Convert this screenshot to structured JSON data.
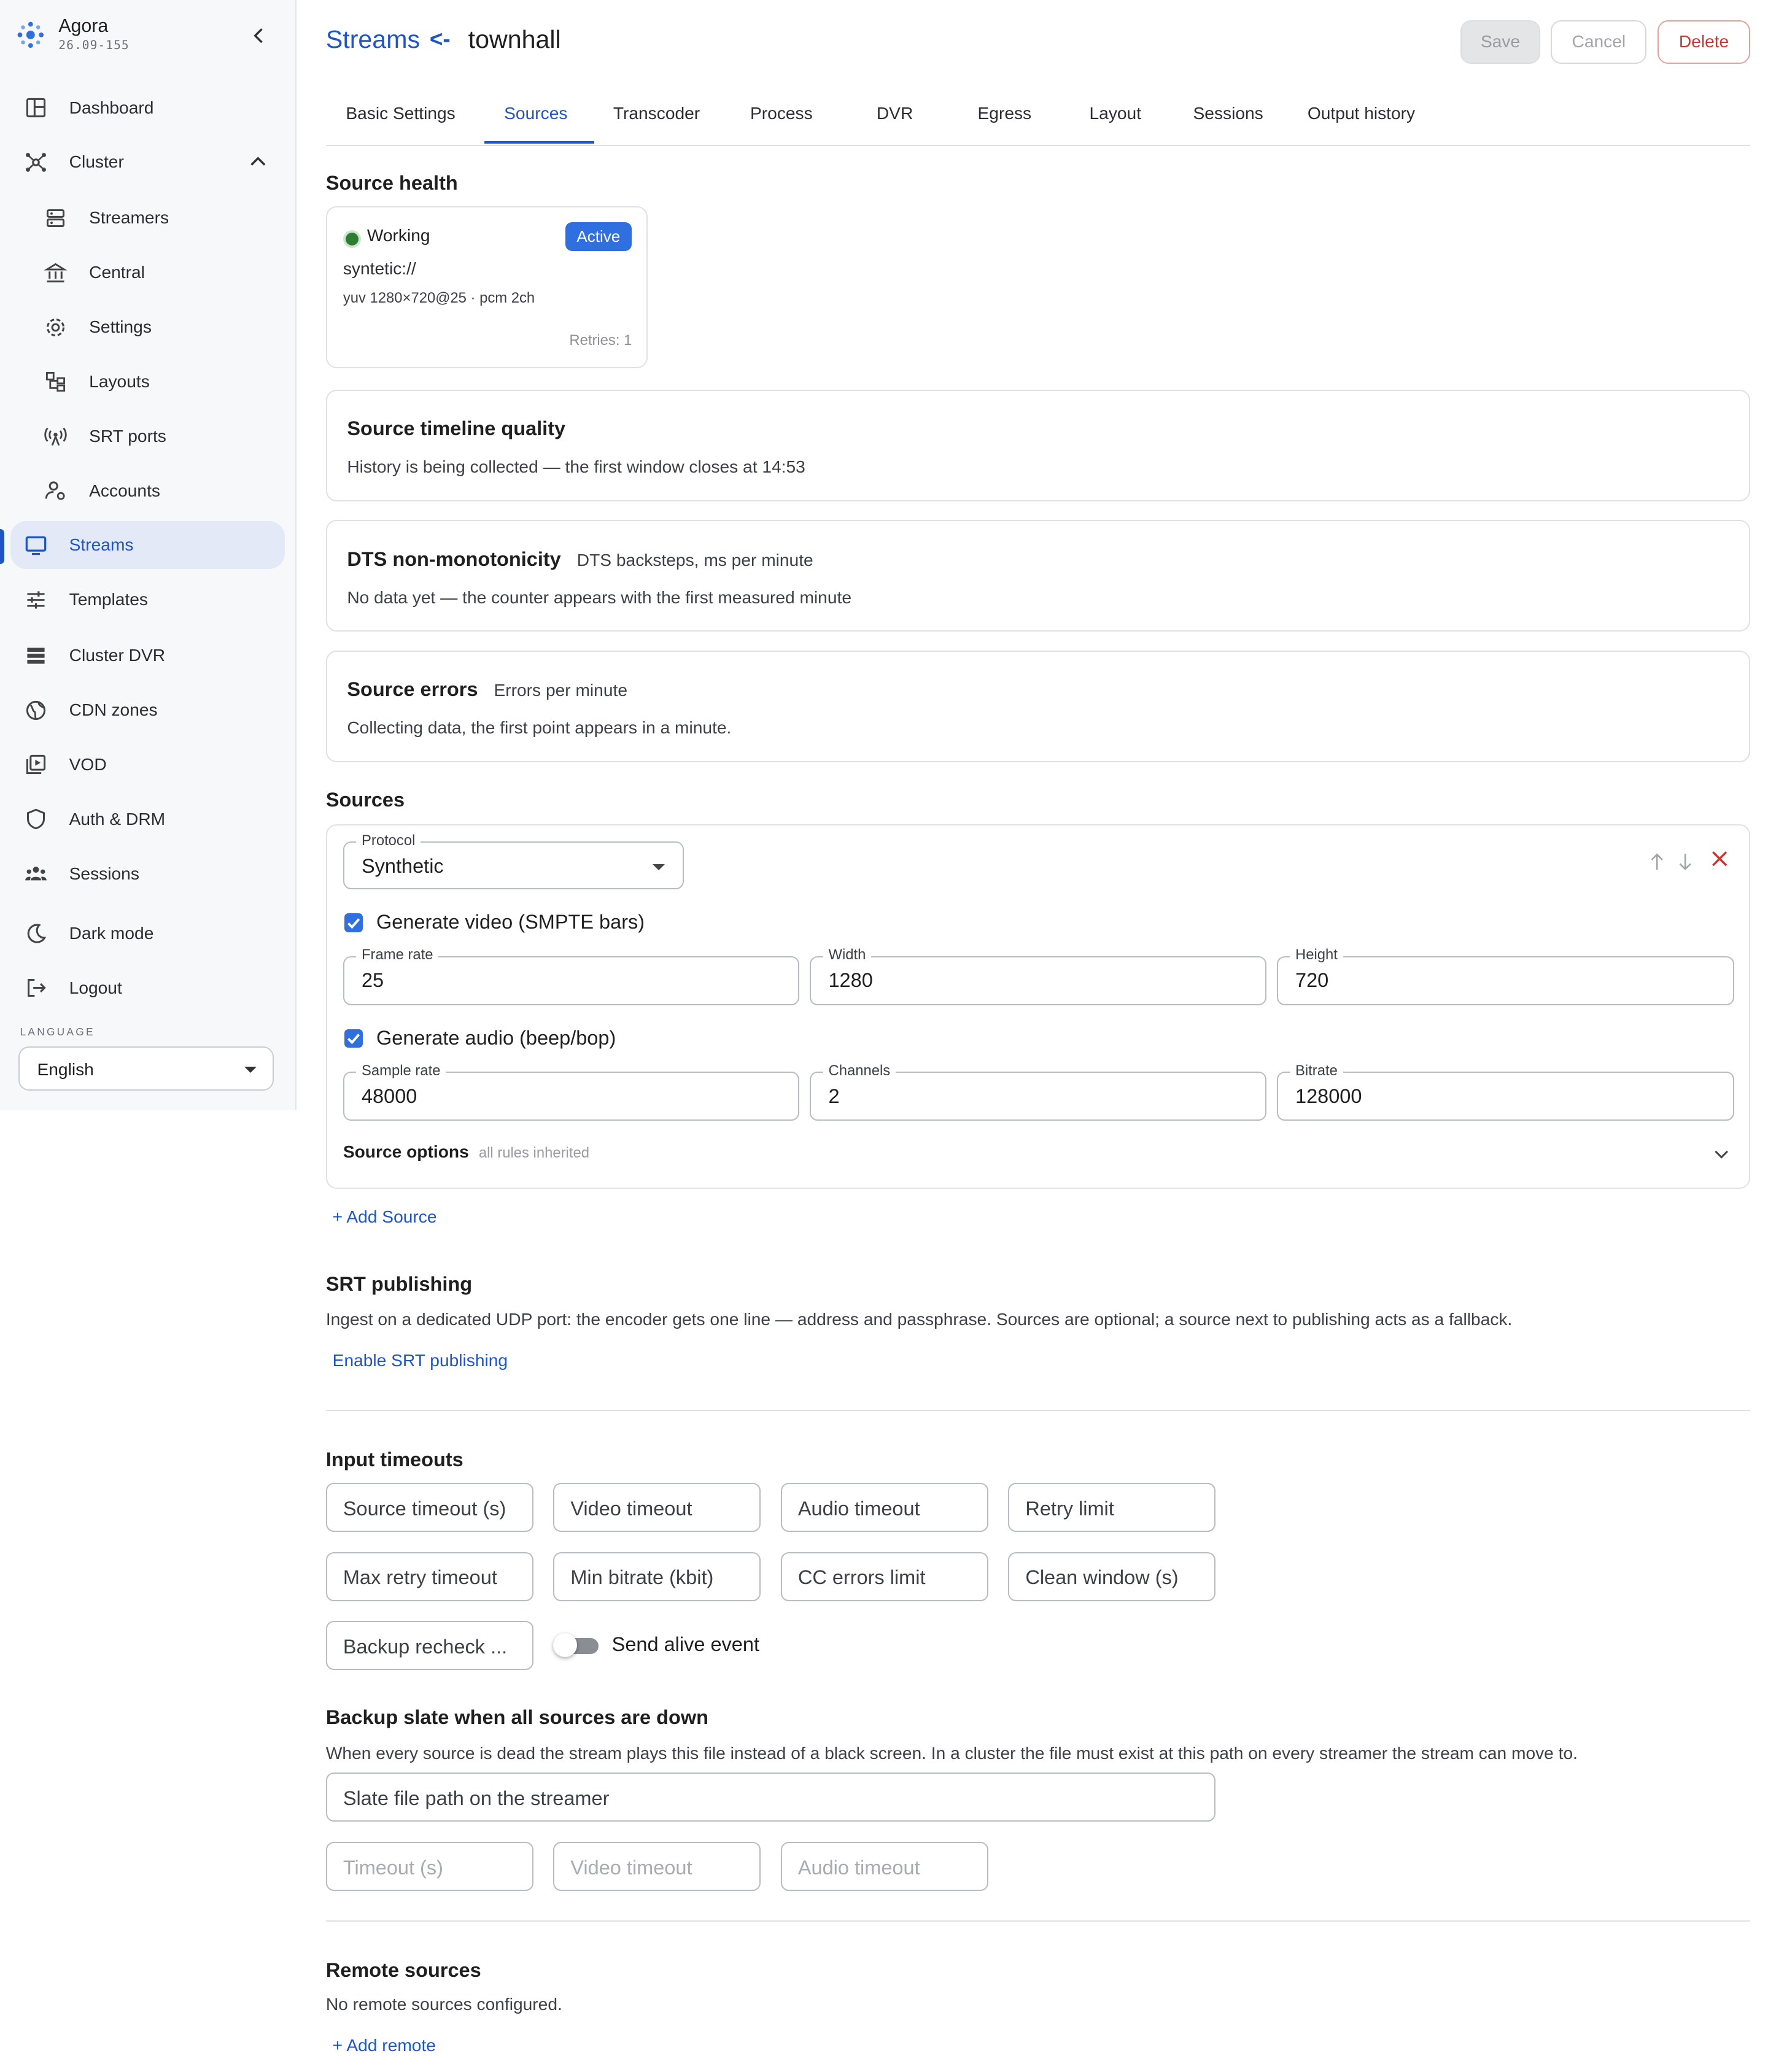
{
  "app": {
    "name": "Agora",
    "version": "26.09-155"
  },
  "sidebar": {
    "items": [
      {
        "label": "Dashboard"
      },
      {
        "label": "Cluster"
      },
      {
        "label": "Streamers"
      },
      {
        "label": "Central"
      },
      {
        "label": "Settings"
      },
      {
        "label": "Layouts"
      },
      {
        "label": "SRT ports"
      },
      {
        "label": "Accounts"
      },
      {
        "label": "Streams"
      },
      {
        "label": "Templates"
      },
      {
        "label": "Cluster DVR"
      },
      {
        "label": "CDN zones"
      },
      {
        "label": "VOD"
      },
      {
        "label": "Auth & DRM"
      },
      {
        "label": "Sessions"
      },
      {
        "label": "Dark mode"
      },
      {
        "label": "Logout"
      }
    ],
    "language_label": "LANGUAGE",
    "language_value": "English"
  },
  "header": {
    "breadcrumb": "Streams",
    "breadcrumb_arrow": "<-",
    "stream_name": "townhall",
    "save": "Save",
    "cancel": "Cancel",
    "delete": "Delete"
  },
  "tabs": [
    {
      "label": "Basic Settings"
    },
    {
      "label": "Sources"
    },
    {
      "label": "Transcoder"
    },
    {
      "label": "Process"
    },
    {
      "label": "DVR"
    },
    {
      "label": "Egress"
    },
    {
      "label": "Layout"
    },
    {
      "label": "Sessions"
    },
    {
      "label": "Output history"
    }
  ],
  "source_health": {
    "title": "Source health",
    "status": "Working",
    "status_color": "#2e7d32",
    "badge": "Active",
    "uri": "syntetic://",
    "format": "yuv 1280×720@25 · pcm 2ch",
    "retries": "Retries: 1"
  },
  "timeline": {
    "title": "Source timeline quality",
    "message": "History is being collected — the first window closes at 14:53"
  },
  "dts": {
    "title": "DTS non-monotonicity",
    "subtitle": "DTS backsteps, ms per minute",
    "message": "No data yet — the counter appears with the first measured minute"
  },
  "errors": {
    "title": "Source errors",
    "subtitle": "Errors per minute",
    "message": "Collecting data, the first point appears in a minute."
  },
  "sources": {
    "title": "Sources",
    "protocol_label": "Protocol",
    "protocol_value": "Synthetic",
    "video_checkbox": "Generate video (SMPTE bars)",
    "video_checked": true,
    "frame_rate_label": "Frame rate",
    "frame_rate": "25",
    "width_label": "Width",
    "width": "1280",
    "height_label": "Height",
    "height": "720",
    "audio_checkbox": "Generate audio (beep/bop)",
    "audio_checked": true,
    "sample_rate_label": "Sample rate",
    "sample_rate": "48000",
    "channels_label": "Channels",
    "channels": "2",
    "bitrate_label": "Bitrate",
    "bitrate": "128000",
    "options_title": "Source options",
    "options_sub": "all rules inherited",
    "add_source": "+ Add Source"
  },
  "srt": {
    "title": "SRT publishing",
    "description": "Ingest on a dedicated UDP port: the encoder gets one line — address and passphrase. Sources are optional; a source next to publishing acts as a fallback.",
    "enable": "Enable SRT publishing"
  },
  "timeouts": {
    "title": "Input timeouts",
    "fields": [
      "Source timeout (s)",
      "Video timeout",
      "Audio timeout",
      "Retry limit",
      "Max retry timeout",
      "Min bitrate (kbit)",
      "CC errors limit",
      "Clean window (s)",
      "Backup recheck ..."
    ],
    "alive_label": "Send alive event",
    "alive_on": false
  },
  "slate": {
    "title": "Backup slate when all sources are down",
    "description": "When every source is dead the stream plays this file instead of a black screen. In a cluster the file must exist at this path on every streamer the stream can move to.",
    "path_placeholder": "Slate file path on the streamer",
    "timeout_placeholder": "Timeout (s)",
    "video_placeholder": "Video timeout",
    "audio_placeholder": "Audio timeout"
  },
  "remote": {
    "title": "Remote sources",
    "message": "No remote sources configured.",
    "add": "+ Add remote"
  },
  "colors": {
    "accent": "#1f55c7",
    "danger": "#d0342c",
    "badge": "#2f6fe0"
  }
}
